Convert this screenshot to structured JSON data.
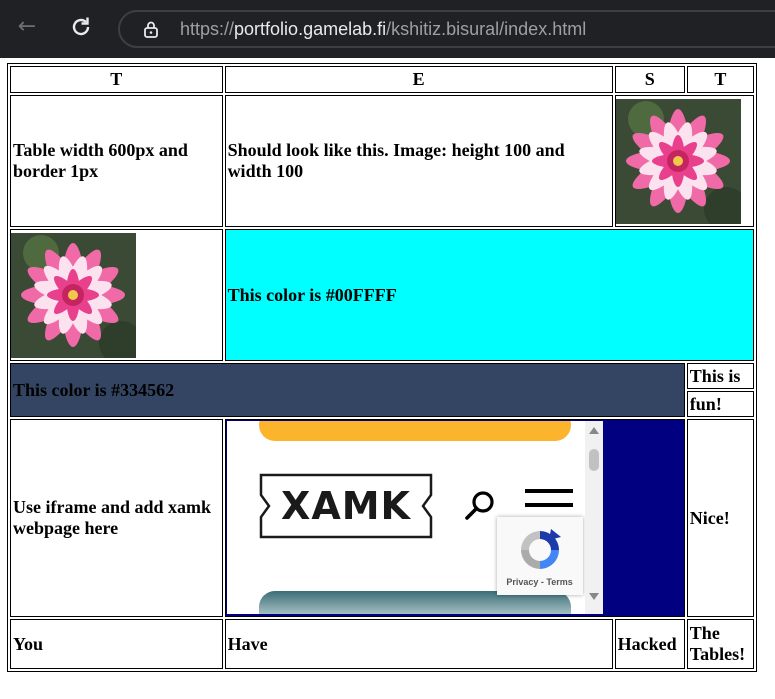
{
  "browser": {
    "url_host": "portfolio.gamelab.fi",
    "url_scheme": "https://",
    "url_path": "/kshitiz.bisural/index.html"
  },
  "table": {
    "headers": [
      "T",
      "E",
      "S",
      "T"
    ],
    "row1": {
      "cell1": "Table width 600px and border 1px",
      "cell2": "Should look like this. Image: height 100 and width 100"
    },
    "row2": {
      "color_text": "This color is #00FFFF",
      "color": "#00FFFF"
    },
    "row3": {
      "color_text": "This color is #334562",
      "color": "#334562",
      "side_top": "This is",
      "side_bottom": "fun!"
    },
    "row4": {
      "text_line1": "Use iframe and add xamk",
      "text_line2": "webpage here",
      "side": "Nice!"
    },
    "row5": {
      "c1": "You",
      "c2": "Have",
      "c3": "Hacked",
      "c4": "The Tables!"
    }
  },
  "iframe": {
    "logo_text": "XAMK",
    "recaptcha_text": "Privacy - Terms"
  }
}
